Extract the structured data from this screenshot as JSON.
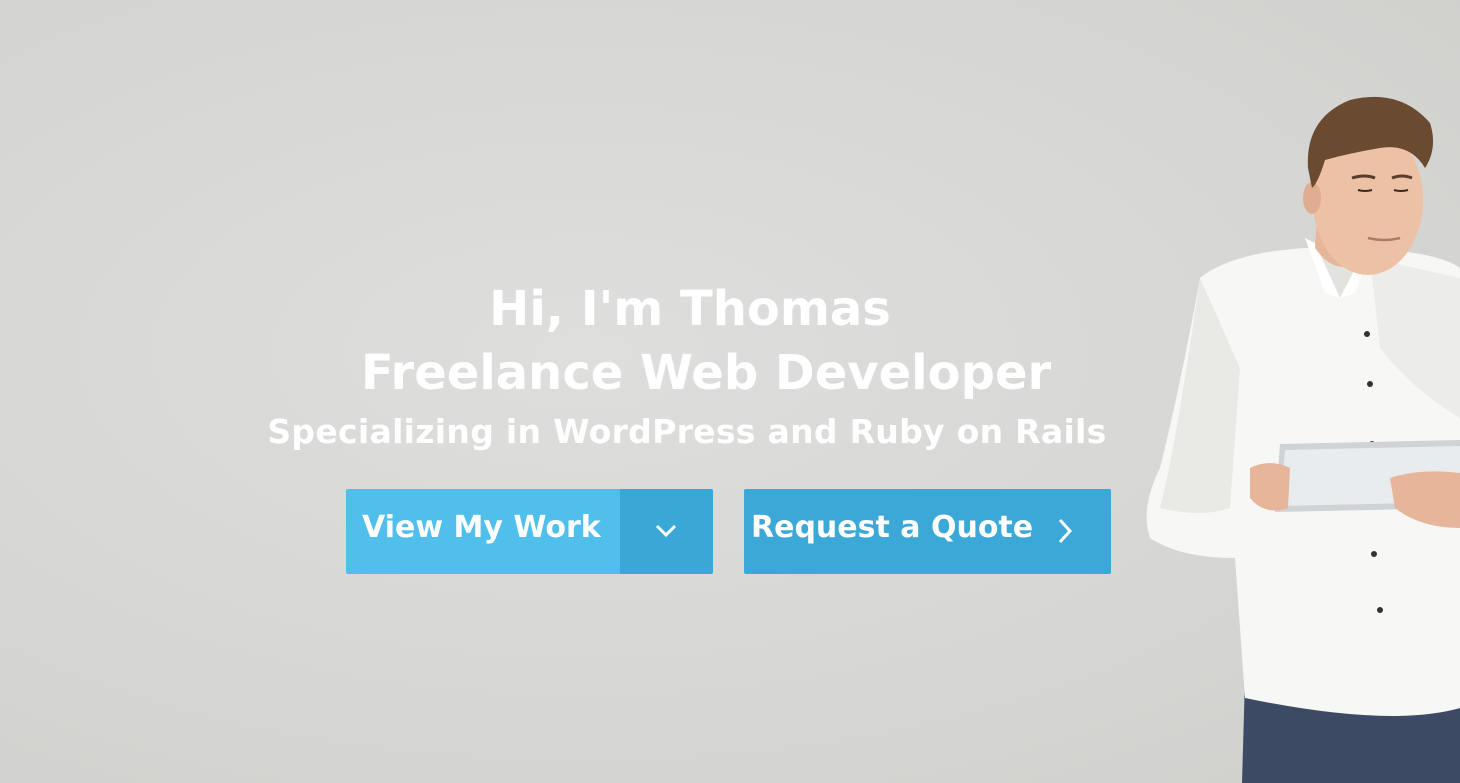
{
  "hero": {
    "greeting": "Hi, I'm Thomas",
    "title": "Freelance Web Developer",
    "subtitle": "Specializing in WordPress and Ruby on Rails"
  },
  "buttons": {
    "view_work_label": "View My Work",
    "view_work_icon": "chevron-down-icon",
    "quote_label": "Request a Quote",
    "quote_icon": "chevron-right-icon"
  },
  "colors": {
    "background": "#d6d6d4",
    "text": "#ffffff",
    "button_primary": "#50bfec",
    "button_primary_dark": "#3aa8d6",
    "button_secondary": "#3ba8d7"
  }
}
